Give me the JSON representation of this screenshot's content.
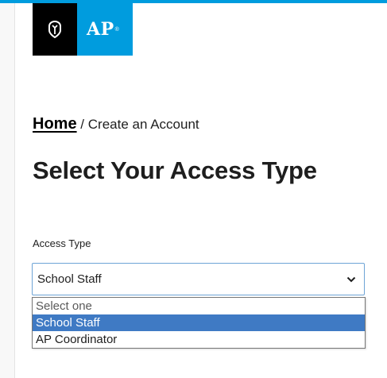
{
  "brand": {
    "logo_text": "AP",
    "logo_mark": "®",
    "accent_color": "#009cde",
    "icon": "college-board-acorn-icon"
  },
  "breadcrumb": {
    "home_label": "Home",
    "separator": " / ",
    "current": "Create an Account"
  },
  "page_title": "Select Your Access Type",
  "form": {
    "access_type_label": "Access Type",
    "selected_value": "School Staff",
    "options": [
      {
        "label": "Select one",
        "state": "placeholder"
      },
      {
        "label": "School Staff",
        "state": "highlighted"
      },
      {
        "label": "AP Coordinator",
        "state": "normal"
      }
    ],
    "highlight_color": "#3f7ac4"
  }
}
